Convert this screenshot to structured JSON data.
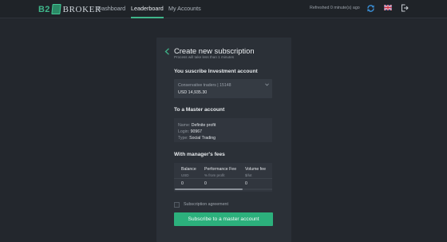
{
  "brand": {
    "prefix": "B2",
    "name": "BROKER"
  },
  "nav": {
    "items": [
      {
        "label": "Dashboard",
        "active": false
      },
      {
        "label": "Leaderboard",
        "active": true
      },
      {
        "label": "My Accounts",
        "active": false
      }
    ],
    "refreshed": "Refreshed 0 minute(s) ago"
  },
  "icons": [
    "refresh-icon",
    "uk-flag-icon",
    "logout-icon",
    "chevron-left-icon",
    "chevron-down-icon"
  ],
  "colors": {
    "accent": "#2cb07c",
    "background": "#23272d",
    "card": "#2b3037"
  },
  "card": {
    "title": "Create new subscription",
    "subtitle": "Process will take less than 1 minutes",
    "investment": {
      "heading": "You suscribe Investment account",
      "select_label": "Conservative traders | 15148",
      "select_value": "USD 14,935.30"
    },
    "master": {
      "heading": "To a Master account",
      "name_key": "Name:",
      "name_value": "Definite profit",
      "login_key": "Login:",
      "login_value": "90967",
      "type_key": "Type:",
      "type_value": "Social Trading"
    },
    "fees": {
      "heading": "With manager's fees",
      "columns": [
        {
          "header": "Balance",
          "sub": "USD",
          "value": "0"
        },
        {
          "header": "Performance Fee",
          "sub": "% from profit",
          "value": "0"
        },
        {
          "header": "Volume fee",
          "sub": "$/lot",
          "value": "0"
        }
      ]
    },
    "agreement_label": "Subscription agreement",
    "agreement_checked": false,
    "submit_label": "Subscribe to a master account"
  }
}
